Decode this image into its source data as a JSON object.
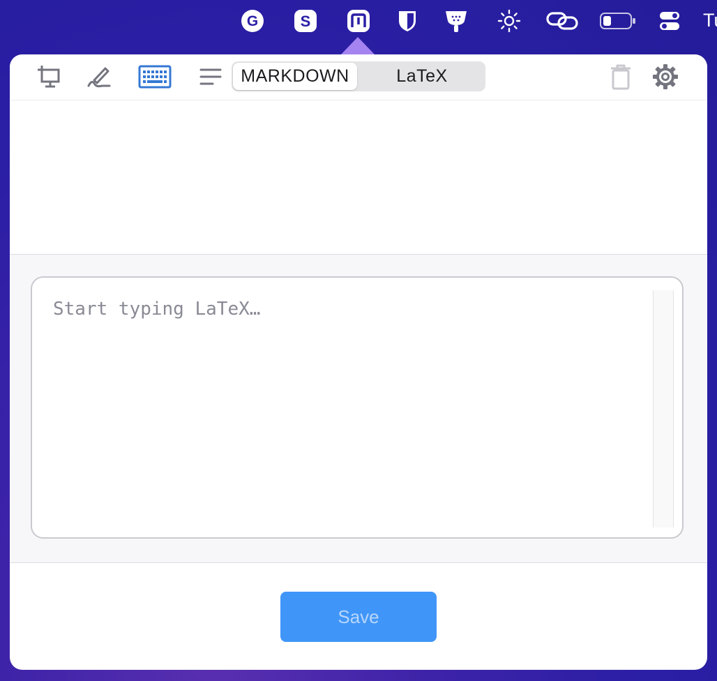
{
  "menubar": {
    "items": [
      {
        "name": "grammarly-icon",
        "glyph": "G"
      },
      {
        "name": "skype-icon",
        "glyph": "S"
      },
      {
        "name": "mathpix-icon"
      },
      {
        "name": "bitwarden-shield-icon"
      },
      {
        "name": "shower-head-icon"
      },
      {
        "name": "brightness-icon"
      },
      {
        "name": "link-icon"
      },
      {
        "name": "battery-icon"
      },
      {
        "name": "control-center-icon"
      }
    ],
    "overflow_text": "Tu"
  },
  "toolbar": {
    "icons": [
      "screenshot-crop-icon",
      "handwriting-pen-icon",
      "keyboard-icon",
      "text-align-icon",
      "trash-icon",
      "gear-icon"
    ],
    "active_icon": "keyboard-icon",
    "mode_tabs": [
      {
        "label": "MARKDOWN",
        "selected": true
      },
      {
        "label": "LaTeX",
        "selected": false
      }
    ]
  },
  "editor": {
    "placeholder": "Start typing LaTeX…",
    "value": ""
  },
  "save_label": "Save",
  "colors": {
    "accent": "#3478d4",
    "save_button": "#4096f8",
    "icon_gray": "#74747f",
    "background_purple": "#2b1fa6"
  }
}
